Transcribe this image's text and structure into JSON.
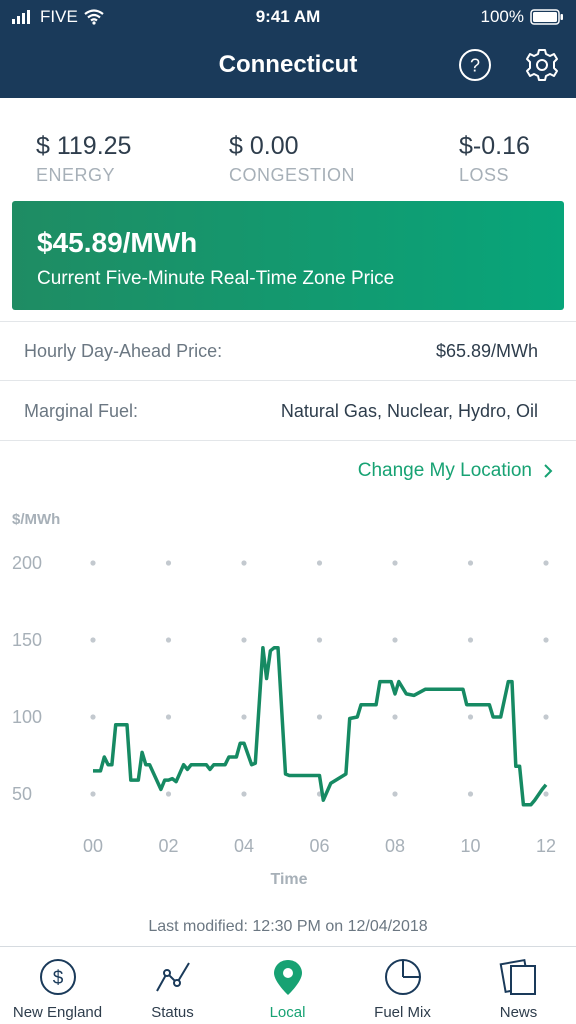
{
  "status_bar": {
    "carrier": "FIVE",
    "time": "9:41 AM",
    "battery": "100%"
  },
  "header": {
    "title": "Connecticut",
    "help_icon": "question-circle-icon",
    "settings_icon": "gear-icon"
  },
  "stats": [
    {
      "value": "$ 119.25",
      "label": "ENERGY"
    },
    {
      "value": "$ 0.00",
      "label": "CONGESTION"
    },
    {
      "value": "$-0.16",
      "label": "LOSS"
    }
  ],
  "price_card": {
    "price": "$45.89/MWh",
    "subtitle": "Current Five-Minute Real-Time Zone Price"
  },
  "rows": {
    "day_ahead": {
      "label": "Hourly Day-Ahead Price:",
      "value": "$65.89/MWh"
    },
    "marginal_fuel": {
      "label": "Marginal Fuel:",
      "value": "Natural Gas, Nuclear, Hydro, Oil"
    }
  },
  "change_location": {
    "label": "Change My Location",
    "icon": "chevron-right-icon"
  },
  "chart_data": {
    "type": "line",
    "ylabel": "$/MWh",
    "xlabel": "Time",
    "xlim": [
      0,
      12
    ],
    "ylim": [
      50,
      200
    ],
    "x_ticks": [
      "00",
      "02",
      "04",
      "06",
      "08",
      "10",
      "12"
    ],
    "y_ticks": [
      "50",
      "100",
      "150",
      "200"
    ],
    "grid": "dotted",
    "color": "#168a63",
    "series": [
      {
        "x": [
          0,
          0.2,
          0.3,
          0.4,
          0.5,
          0.6,
          0.9,
          1.0,
          1.2,
          1.3,
          1.4,
          1.5,
          1.8,
          1.9,
          2.0,
          2.1,
          2.2,
          2.4,
          2.5,
          2.6,
          2.8,
          3.0,
          3.1,
          3.2,
          3.5,
          3.6,
          3.8,
          3.9,
          4.0,
          4.2,
          4.3,
          4.5,
          4.6,
          4.7,
          4.8,
          4.9,
          5.1,
          5.2,
          5.5,
          6.0,
          6.1,
          6.3,
          6.7,
          6.8,
          7.0,
          7.1,
          7.5,
          7.6,
          7.9,
          8.0,
          8.1,
          8.3,
          8.5,
          8.8,
          9.0,
          9.8,
          9.9,
          10.5,
          10.6,
          10.8,
          11.0,
          11.1,
          11.2,
          11.3,
          11.4,
          11.5,
          11.6,
          11.7,
          11.9,
          12.0
        ],
        "y": [
          65,
          65,
          74,
          69,
          69,
          95,
          95,
          59,
          59,
          77,
          69,
          69,
          53,
          59,
          59,
          60,
          58,
          69,
          66,
          69,
          69,
          69,
          66,
          69,
          69,
          74,
          74,
          83,
          83,
          69,
          70,
          145,
          125,
          143,
          145,
          145,
          63,
          62,
          62,
          62,
          46,
          57,
          63,
          99,
          100,
          108,
          108,
          123,
          123,
          115,
          123,
          115,
          114,
          118,
          118,
          118,
          108,
          108,
          100,
          100,
          123,
          123,
          68,
          68,
          43,
          43,
          43,
          46,
          53,
          56
        ]
      }
    ]
  },
  "last_modified": "Last modified: 12:30 PM on 12/04/2018",
  "tabs": [
    {
      "label": "New England",
      "icon": "dollar-circle-icon",
      "active": false
    },
    {
      "label": "Status",
      "icon": "trend-line-icon",
      "active": false
    },
    {
      "label": "Local",
      "icon": "location-pin-icon",
      "active": true
    },
    {
      "label": "Fuel Mix",
      "icon": "pie-chart-icon",
      "active": false
    },
    {
      "label": "News",
      "icon": "news-pages-icon",
      "active": false
    }
  ]
}
